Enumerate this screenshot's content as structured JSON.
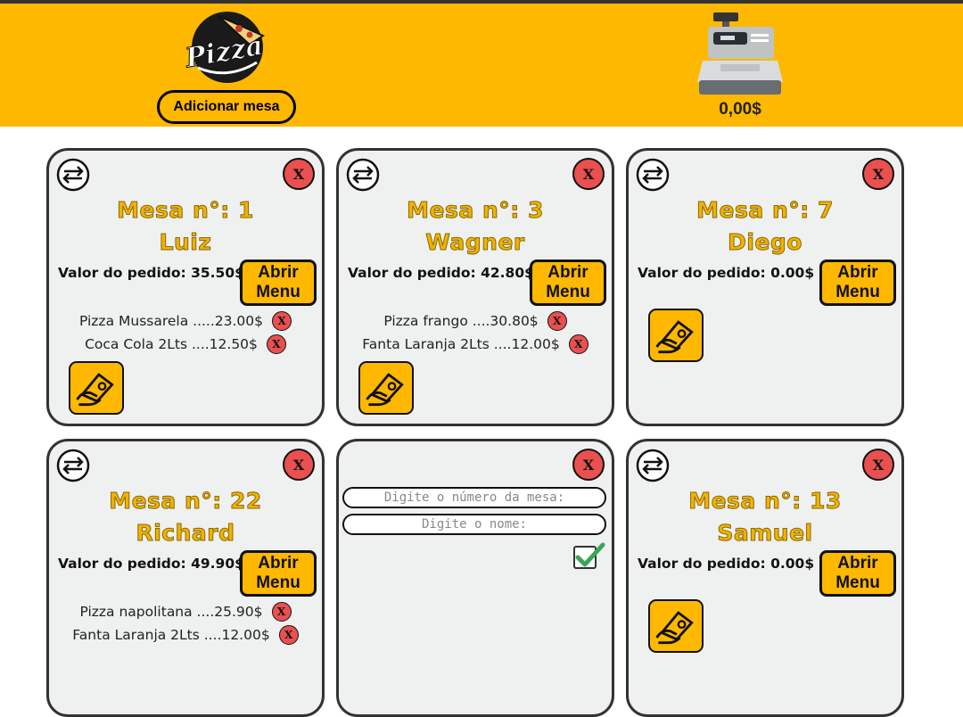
{
  "header": {
    "logo_text": "Pizza",
    "add_table_label": "Adicionar mesa",
    "cash_total": "0,00$",
    "brand_color": "#ffb800"
  },
  "tables": [
    {
      "title": "Mesa n°: 1",
      "name": "Luiz",
      "order_value": "Valor do pedido: 35.50$",
      "menu_label": "Abrir Menu",
      "close_label": "X",
      "items": [
        {
          "label": "Pizza Mussarela .....23.00$",
          "remove": "X"
        },
        {
          "label": "Coca Cola 2Lts ....12.50$",
          "remove": "X"
        }
      ]
    },
    {
      "title": "Mesa n°: 3",
      "name": "Wagner",
      "order_value": "Valor do pedido: 42.80$",
      "menu_label": "Abrir Menu",
      "close_label": "X",
      "items": [
        {
          "label": "Pizza frango ....30.80$",
          "remove": "X"
        },
        {
          "label": "Fanta Laranja 2Lts ....12.00$",
          "remove": "X"
        }
      ]
    },
    {
      "title": "Mesa n°: 7",
      "name": "Diego",
      "order_value": "Valor do pedido: 0.00$",
      "menu_label": "Abrir Menu",
      "close_label": "X",
      "items": []
    },
    {
      "title": "Mesa n°: 22",
      "name": "Richard",
      "order_value": "Valor do pedido: 49.90$",
      "menu_label": "Abrir Menu",
      "close_label": "X",
      "items": [
        {
          "label": "Pizza napolitana ....25.90$",
          "remove": "X"
        },
        {
          "label": "Fanta Laranja 2Lts ....12.00$",
          "remove": "X"
        }
      ]
    },
    {
      "close_label": "X",
      "table_number_placeholder": "Digite o número da mesa:",
      "name_placeholder": "Digite o nome:"
    },
    {
      "title": "Mesa n°: 13",
      "name": "Samuel",
      "order_value": "Valor do pedido: 0.00$",
      "menu_label": "Abrir Menu",
      "close_label": "X",
      "items": []
    }
  ],
  "icons": {
    "swap": "swap-arrows-icon",
    "close": "close-x-icon",
    "pay": "hand-money-icon",
    "confirm": "checkbox-check-icon",
    "register": "cash-register-icon"
  }
}
